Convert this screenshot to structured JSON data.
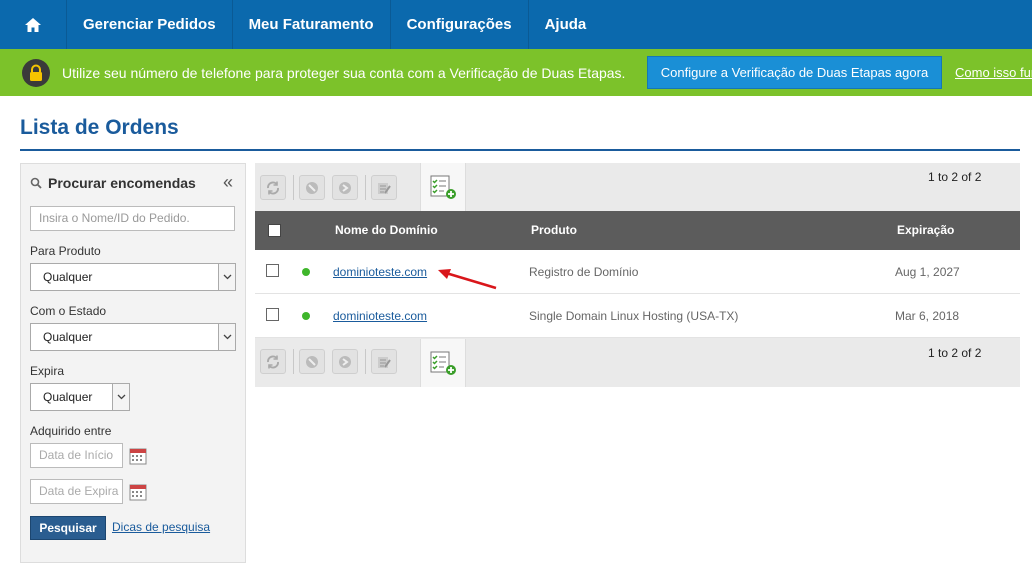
{
  "nav": {
    "items": [
      "Gerenciar Pedidos",
      "Meu Faturamento",
      "Configurações",
      "Ajuda"
    ]
  },
  "banner": {
    "message": "Utilize seu número de telefone para proteger sua conta com a Verificação de Duas Etapas.",
    "cta": "Configure a Verificação de Duas Etapas agora",
    "how": "Como isso fun"
  },
  "page": {
    "title": "Lista de Ordens"
  },
  "sidebar": {
    "title": "Procurar encomendas",
    "collapse": "«",
    "search_placeholder": "Insira o Nome/ID do Pedido.",
    "product_label": "Para Produto",
    "product_value": "Qualquer",
    "state_label": "Com o Estado",
    "state_value": "Qualquer",
    "expires_label": "Expira",
    "expires_value": "Qualquer",
    "acquired_label": "Adquirido entre",
    "start_placeholder": "Data de Início",
    "end_placeholder": "Data de Expira",
    "search_button": "Pesquisar",
    "tips_link": "Dicas de pesquisa"
  },
  "table": {
    "count": "1 to 2 of 2",
    "headers": {
      "domain": "Nome do Domínio",
      "product": "Produto",
      "expiration": "Expiração"
    },
    "rows": [
      {
        "domain": "dominioteste.com",
        "product": "Registro de Domínio",
        "expiration": "Aug 1, 2027",
        "status_color": "#3fb62b"
      },
      {
        "domain": "dominioteste.com",
        "product": "Single Domain Linux Hosting (USA-TX)",
        "expiration": "Mar 6, 2018",
        "status_color": "#3fb62b"
      }
    ]
  },
  "colors": {
    "nav": "#0b69ad",
    "banner": "#7cc22a",
    "accent": "#1a5b9c",
    "annotation_arrow": "#d9161b"
  }
}
